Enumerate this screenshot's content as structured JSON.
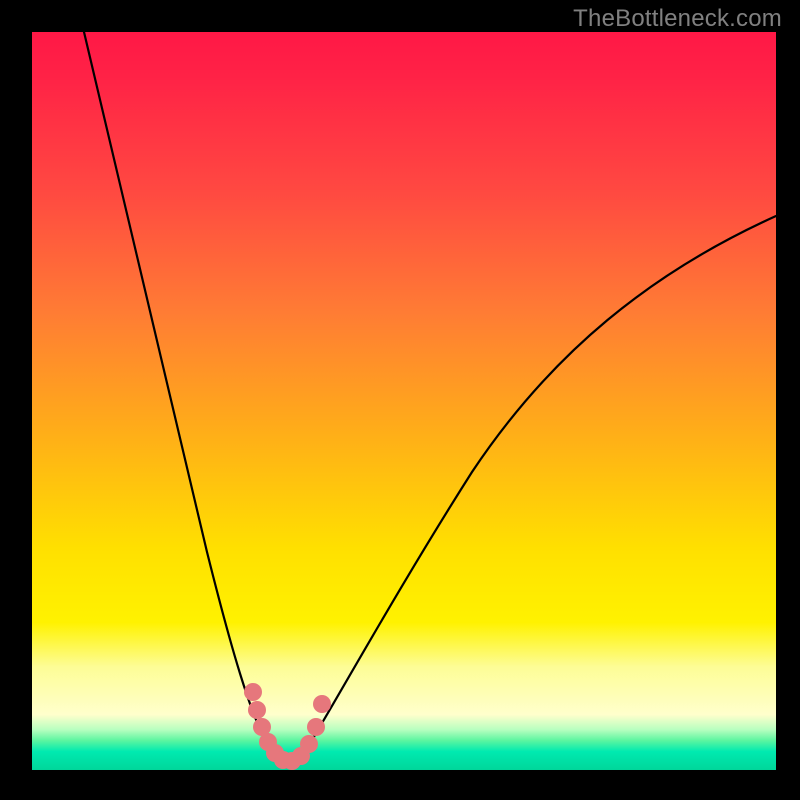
{
  "watermark": "TheBottleneck.com",
  "colors": {
    "page_bg": "#000000",
    "curve_stroke": "#000000",
    "dot_fill": "#e6777c",
    "gradient_top": "#ff1846",
    "gradient_mid": "#ffe000",
    "gradient_bottom": "#00d69a"
  },
  "chart_data": {
    "type": "line",
    "title": "",
    "xlabel": "",
    "ylabel": "",
    "xlim": [
      0,
      100
    ],
    "ylim": [
      0,
      100
    ],
    "grid": false,
    "legend": false,
    "series": [
      {
        "name": "bottleneck-curve",
        "x": [
          7,
          10,
          14,
          18,
          22,
          25,
          27,
          29,
          30.5,
          32,
          33,
          34,
          36,
          38,
          40,
          43,
          47,
          52,
          58,
          65,
          74,
          85,
          100
        ],
        "y": [
          100,
          86,
          70,
          55,
          40,
          28,
          20,
          12,
          6,
          2,
          0,
          0,
          2,
          6,
          12,
          20,
          30,
          40,
          50,
          58,
          66,
          73,
          80
        ]
      }
    ],
    "highlight_points": [
      {
        "x": 29.5,
        "y": 10
      },
      {
        "x": 30.2,
        "y": 6
      },
      {
        "x": 31.0,
        "y": 3
      },
      {
        "x": 31.8,
        "y": 1.2
      },
      {
        "x": 32.6,
        "y": 0.4
      },
      {
        "x": 33.5,
        "y": 0.2
      },
      {
        "x": 34.5,
        "y": 0.3
      },
      {
        "x": 35.5,
        "y": 0.8
      },
      {
        "x": 36.5,
        "y": 2.0
      },
      {
        "x": 37.4,
        "y": 4.5
      },
      {
        "x": 38.2,
        "y": 8.5
      }
    ],
    "notes": "V-shaped bottleneck curve over a heat-map gradient background. Minimum near x≈33. Salmon dots mark samples around the trough. Axes are unlabeled; values are percent-of-range estimates read from geometry."
  }
}
